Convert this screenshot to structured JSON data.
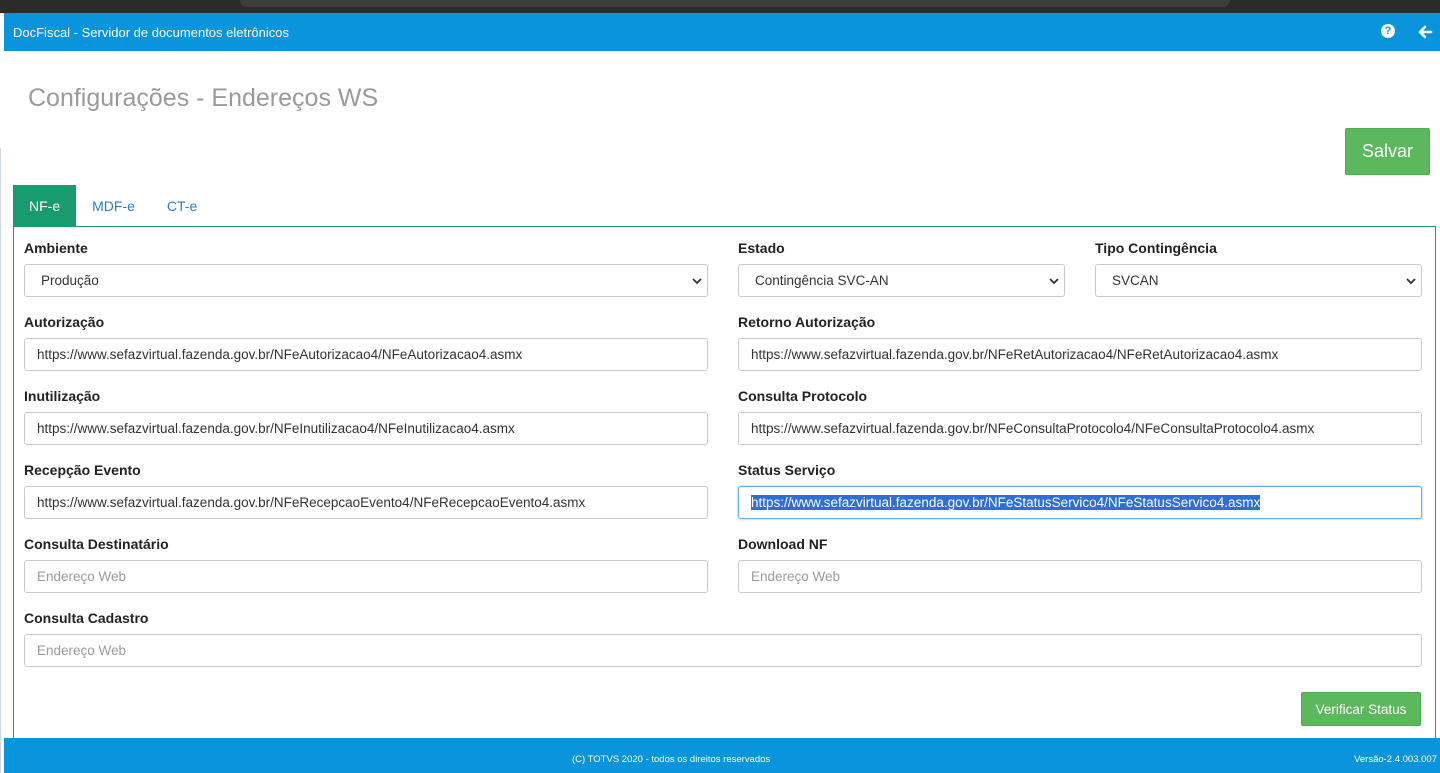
{
  "header": {
    "title": "DocFiscal - Servidor de documentos eletrônicos",
    "help_icon": "question-circle-icon",
    "back_icon": "arrow-left-icon"
  },
  "page": {
    "title": "Configurações - Endereços WS",
    "save_label": "Salvar"
  },
  "tabs": [
    {
      "label": "NF-e",
      "active": true
    },
    {
      "label": "MDF-e",
      "active": false
    },
    {
      "label": "CT-e",
      "active": false
    }
  ],
  "form": {
    "ambiente": {
      "label": "Ambiente",
      "value": "Produção"
    },
    "estado": {
      "label": "Estado",
      "value": "Contingência SVC-AN"
    },
    "tipo_contingencia": {
      "label": "Tipo Contingência",
      "value": "SVCAN"
    },
    "autorizacao": {
      "label": "Autorização",
      "value": "https://www.sefazvirtual.fazenda.gov.br/NFeAutorizacao4/NFeAutorizacao4.asmx"
    },
    "retorno_autorizacao": {
      "label": "Retorno Autorização",
      "value": "https://www.sefazvirtual.fazenda.gov.br/NFeRetAutorizacao4/NFeRetAutorizacao4.asmx"
    },
    "inutilizacao": {
      "label": "Inutilização",
      "value": "https://www.sefazvirtual.fazenda.gov.br/NFeInutilizacao4/NFeInutilizacao4.asmx"
    },
    "consulta_protocolo": {
      "label": "Consulta Protocolo",
      "value": "https://www.sefazvirtual.fazenda.gov.br/NFeConsultaProtocolo4/NFeConsultaProtocolo4.asmx"
    },
    "recepcao_evento": {
      "label": "Recepção Evento",
      "value": "https://www.sefazvirtual.fazenda.gov.br/NFeRecepcaoEvento4/NFeRecepcaoEvento4.asmx"
    },
    "status_servico": {
      "label": "Status Serviço",
      "value": "https://www.sefazvirtual.fazenda.gov.br/NFeStatusServico4/NFeStatusServico4.asmx"
    },
    "consulta_destinatario": {
      "label": "Consulta Destinatário",
      "placeholder": "Endereço Web"
    },
    "download_nf": {
      "label": "Download NF",
      "placeholder": "Endereço Web"
    },
    "consulta_cadastro": {
      "label": "Consulta Cadastro",
      "placeholder": "Endereço Web"
    },
    "verify_label": "Verificar Status"
  },
  "footer": {
    "copyright": "(C) TOTVS 2020 - todos os direitos reservados",
    "version": "Versão-2.4.003.007"
  },
  "colors": {
    "header_blue": "#0a94dc",
    "tab_active_green": "#189b6e",
    "button_green": "#5cb85c",
    "selection_blue": "#2d6fd6"
  }
}
